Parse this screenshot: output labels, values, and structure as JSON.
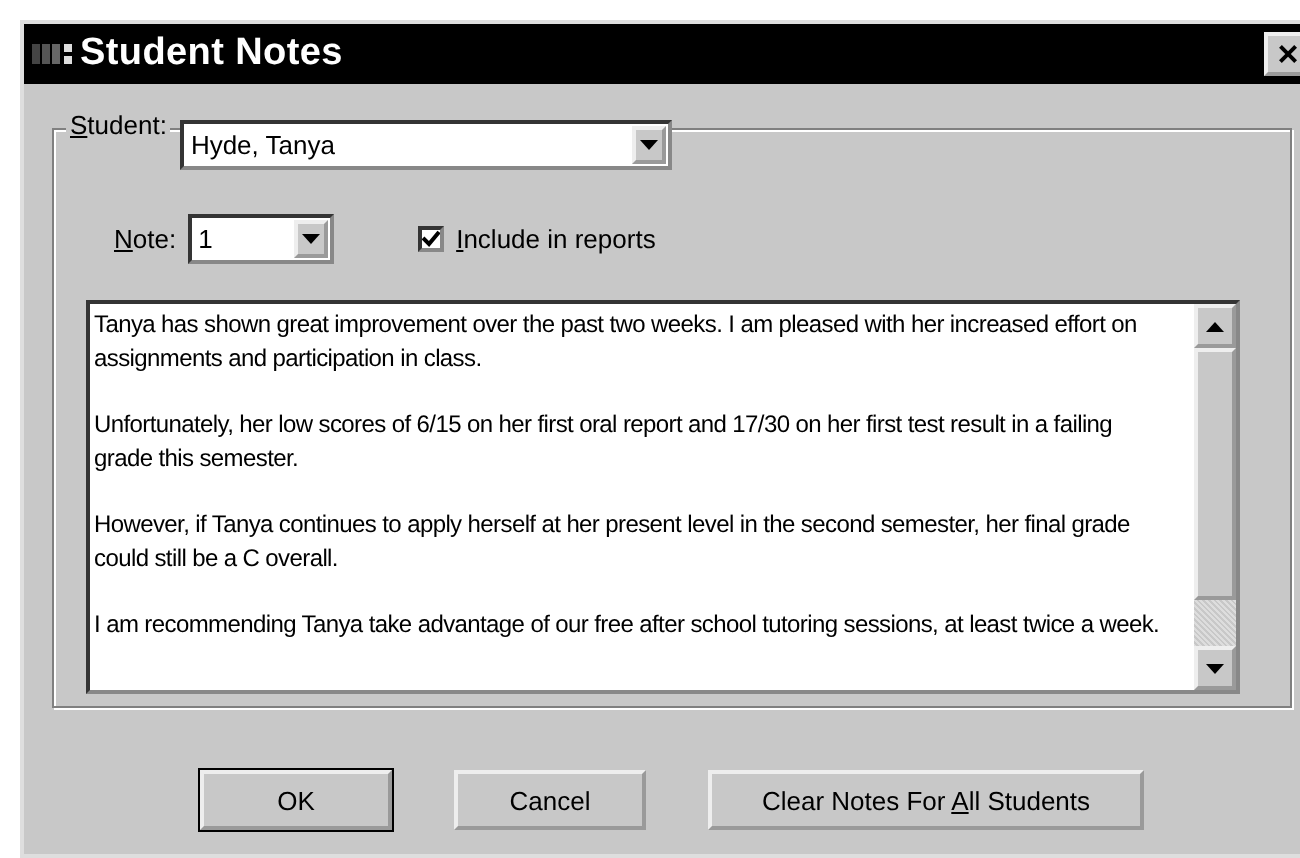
{
  "window": {
    "title": "Student Notes",
    "close": "×"
  },
  "student": {
    "label": {
      "key": "S",
      "after": "tudent:"
    },
    "value": "Hyde, Tanya"
  },
  "note": {
    "label": {
      "key": "N",
      "after": "ote:"
    },
    "value": "1"
  },
  "include": {
    "label": {
      "key": "I",
      "after": "nclude in reports"
    },
    "checked": true
  },
  "notes_text": [
    "Tanya has shown great improvement over the past two weeks. I am pleased with her increased effort on assignments and participation in class.",
    "Unfortunately, her low scores of 6/15 on her first oral report and 17/30 on her first test result in a failing grade this semester.",
    "However, if Tanya continues to apply herself at her present level in the second semester, her final grade could still be a C overall.",
    "I am recommending Tanya take advantage of our free after school tutoring sessions, at least twice a week."
  ],
  "buttons": [
    {
      "label": {
        "before": "OK"
      },
      "default": true
    },
    {
      "label": {
        "before": "Cancel"
      },
      "default": false
    },
    {
      "label": {
        "before": "Clear Notes For ",
        "key": "A",
        "after": "ll Students"
      },
      "default": false
    }
  ]
}
